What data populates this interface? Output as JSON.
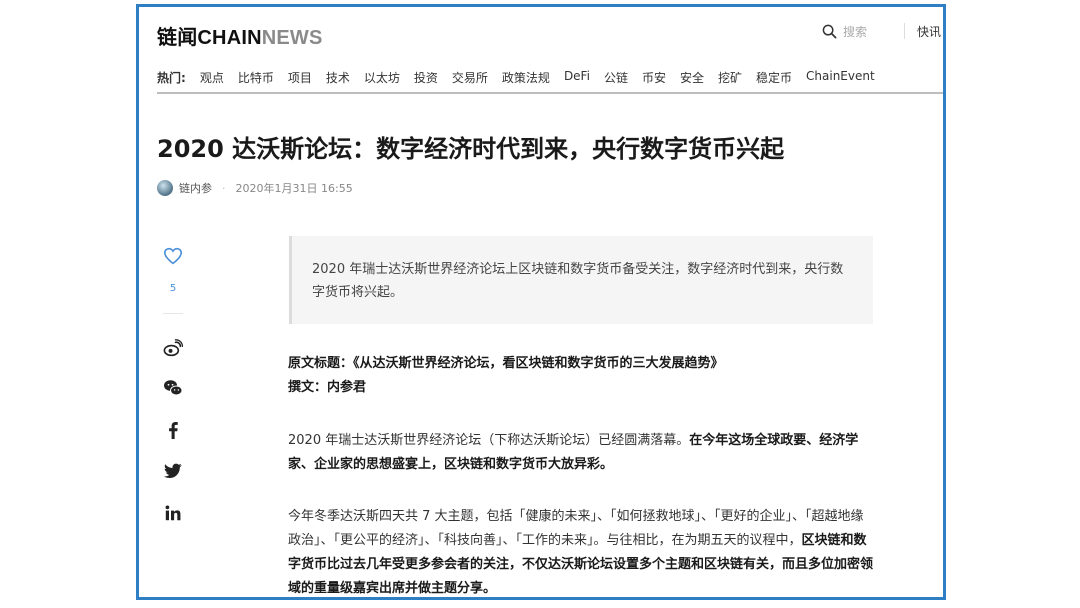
{
  "brand": {
    "cn": "链闻",
    "part1": "CHAIN",
    "part2": "NEWS"
  },
  "header": {
    "search_label": "搜索",
    "flash_label": "快讯"
  },
  "nav": {
    "hot_label": "热门:",
    "items": [
      "观点",
      "比特币",
      "项目",
      "技术",
      "以太坊",
      "投资",
      "交易所",
      "政策法规",
      "DeFi",
      "公链",
      "币安",
      "安全",
      "挖矿",
      "稳定币",
      "ChainEvent"
    ]
  },
  "article": {
    "title": "2020 达沃斯论坛：数字经济时代到来，央行数字货币兴起",
    "author": "链内参",
    "separator": "·",
    "date": "2020年1月31日 16:55",
    "summary": "2020 年瑞士达沃斯世界经济论坛上区块链和数字货币备受关注，数字经济时代到来，央行数字货币将兴起。",
    "original_title": "原文标题：《从达沃斯世界经济论坛，看区块链和数字货币的三大发展趋势》",
    "byline": "撰文：内参君",
    "p1_normal": "2020 年瑞士达沃斯世界经济论坛（下称达沃斯论坛）已经圆满落幕。",
    "p1_bold": "在今年这场全球政要、经济学家、企业家的思想盛宴上，区块链和数字货币大放异彩。",
    "p2_normal": "今年冬季达沃斯四天共 7 大主题，包括「健康的未来」、「如何拯救地球」、「更好的企业」、「超越地缘政治」、「更公平的经济」、「科技向善」、「工作的未来」。与往相比，在为期五天的议程中，",
    "p2_bold": "区块链和数字货币比过去几年受更多参会者的关注，不仅达沃斯论坛设置多个主题和区块链有关，而且多位加密领域的重量级嘉宾出席并做主题分享。"
  },
  "sidebar": {
    "like_count": "5",
    "icons": [
      "heart-icon",
      "weibo-icon",
      "wechat-icon",
      "facebook-icon",
      "twitter-icon",
      "linkedin-icon"
    ]
  },
  "colors": {
    "frame": "#2f7fc4",
    "like": "#4a90d9",
    "summary_bg": "#f5f5f5"
  }
}
